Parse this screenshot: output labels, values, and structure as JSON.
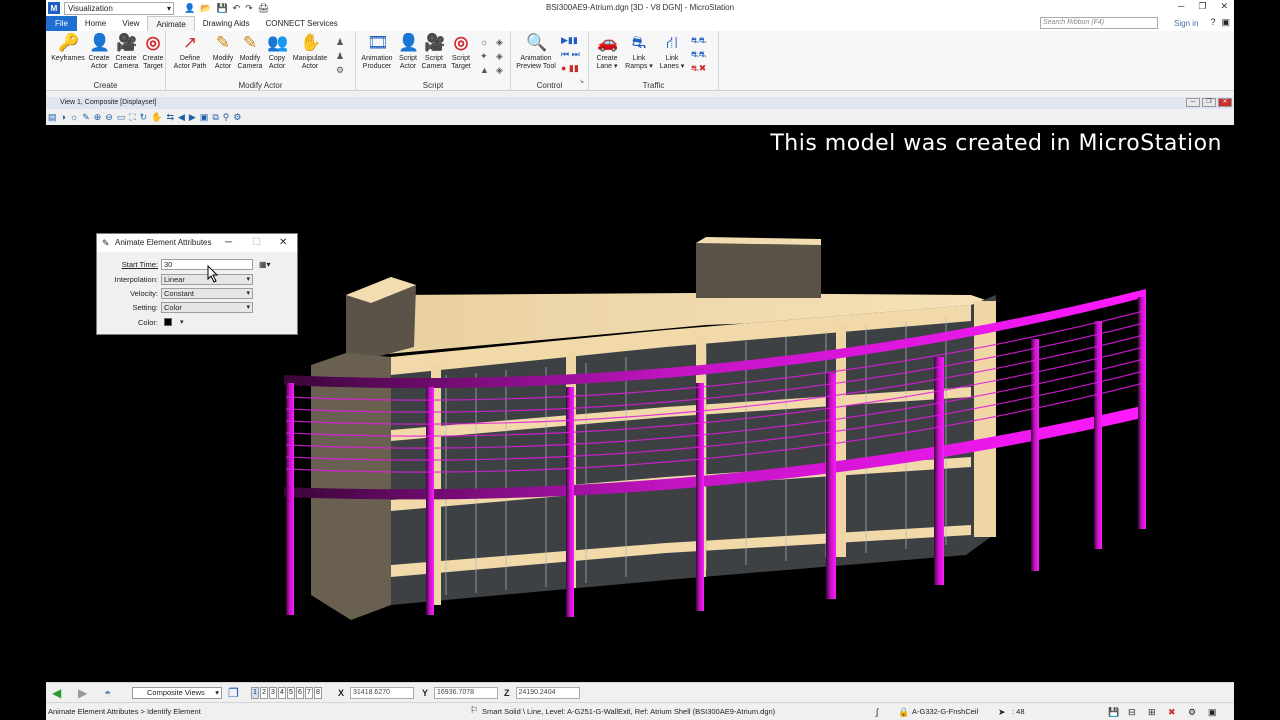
{
  "app": {
    "workflow": "Visualization",
    "window_title": "BSI300AE9-Atrium.dgn [3D - V8 DGN] - MicroStation",
    "search_placeholder": "Search Ribbon (F4)",
    "sign_in": "Sign in"
  },
  "tabs": [
    "File",
    "Home",
    "View",
    "Animate",
    "Drawing Aids",
    "CONNECT Services"
  ],
  "active_tab": "Animate",
  "ribbon": {
    "create": {
      "title": "Create",
      "buttons": [
        {
          "label1": "Keyframes",
          "label2": "",
          "icon": "key-icon",
          "glyph": "🔑"
        },
        {
          "label1": "Create",
          "label2": "Actor",
          "icon": "actor-icon",
          "glyph": "👤"
        },
        {
          "label1": "Create",
          "label2": "Camera",
          "icon": "camera-icon",
          "glyph": "🎥"
        },
        {
          "label1": "Create",
          "label2": "Target",
          "icon": "target-icon",
          "glyph": "◎"
        }
      ]
    },
    "modify_actor": {
      "title": "Modify Actor",
      "buttons": [
        {
          "label1": "Define",
          "label2": "Actor Path",
          "icon": "path-icon",
          "glyph": "↗"
        },
        {
          "label1": "Modify",
          "label2": "Actor",
          "icon": "modify-actor-icon",
          "glyph": "✎"
        },
        {
          "label1": "Modify",
          "label2": "Camera",
          "icon": "modify-camera-icon",
          "glyph": "✎"
        },
        {
          "label1": "Copy",
          "label2": "Actor",
          "icon": "copy-actor-icon",
          "glyph": "👥"
        },
        {
          "label1": "Manipulate",
          "label2": "Actor",
          "icon": "manipulate-actor-icon",
          "glyph": "✋"
        }
      ]
    },
    "script": {
      "title": "Script",
      "buttons": [
        {
          "label1": "Animation",
          "label2": "Producer",
          "icon": "film-icon",
          "glyph": "🎞"
        },
        {
          "label1": "Script",
          "label2": "Actor",
          "icon": "script-actor-icon",
          "glyph": "👤"
        },
        {
          "label1": "Script",
          "label2": "Camera",
          "icon": "script-camera-icon",
          "glyph": "🎥"
        },
        {
          "label1": "Script",
          "label2": "Target",
          "icon": "script-target-icon",
          "glyph": "◎"
        }
      ]
    },
    "control": {
      "title": "Control",
      "buttons": [
        {
          "label1": "Animation",
          "label2": "Preview Tool",
          "icon": "preview-icon",
          "glyph": "🔍"
        }
      ]
    },
    "traffic": {
      "title": "Traffic",
      "buttons": [
        {
          "label1": "Create",
          "label2": "Lane ▾",
          "icon": "car-icon",
          "glyph": "🚗"
        },
        {
          "label1": "Link",
          "label2": "Ramps ▾",
          "icon": "ramp-icon",
          "glyph": "⛐"
        },
        {
          "label1": "Link",
          "label2": "Lanes ▾",
          "icon": "lanes-icon",
          "glyph": "⛙"
        }
      ]
    }
  },
  "view": {
    "title": "View 1, Composite [Displayset]",
    "caption": "This model was created in MicroStation"
  },
  "dialog": {
    "title": "Animate Element Attributes",
    "fields": [
      {
        "label": "Start Time:",
        "value": "30"
      },
      {
        "label": "Interpolation:",
        "value": "Linear"
      },
      {
        "label": "Velocity:",
        "value": "Constant"
      },
      {
        "label": "Setting:",
        "value": "Color"
      },
      {
        "label": "Color:",
        "value": ""
      }
    ]
  },
  "bottom": {
    "views_combo": "Composite Views",
    "view_numbers": [
      "1",
      "2",
      "3",
      "4",
      "5",
      "6",
      "7",
      "8"
    ],
    "x_label": "X",
    "x_value": "31418.6270",
    "y_label": "Y",
    "y_value": "16936.7078",
    "z_label": "Z",
    "z_value": "24190.2404"
  },
  "status": {
    "prompt": "Animate Element Attributes > Identify Element",
    "message": "Smart Solid \\ Line, Level: A-G251-G-WallExtl, Ref: Atrium Shell (BSI300AE9-Atrium.dgn)",
    "active_level": "A-G332-G-FnshCeil",
    "count": ": 48"
  },
  "colors": {
    "accent": "#1e6fd0",
    "railing": "#ff1aff",
    "building": "#f3dcb0"
  }
}
